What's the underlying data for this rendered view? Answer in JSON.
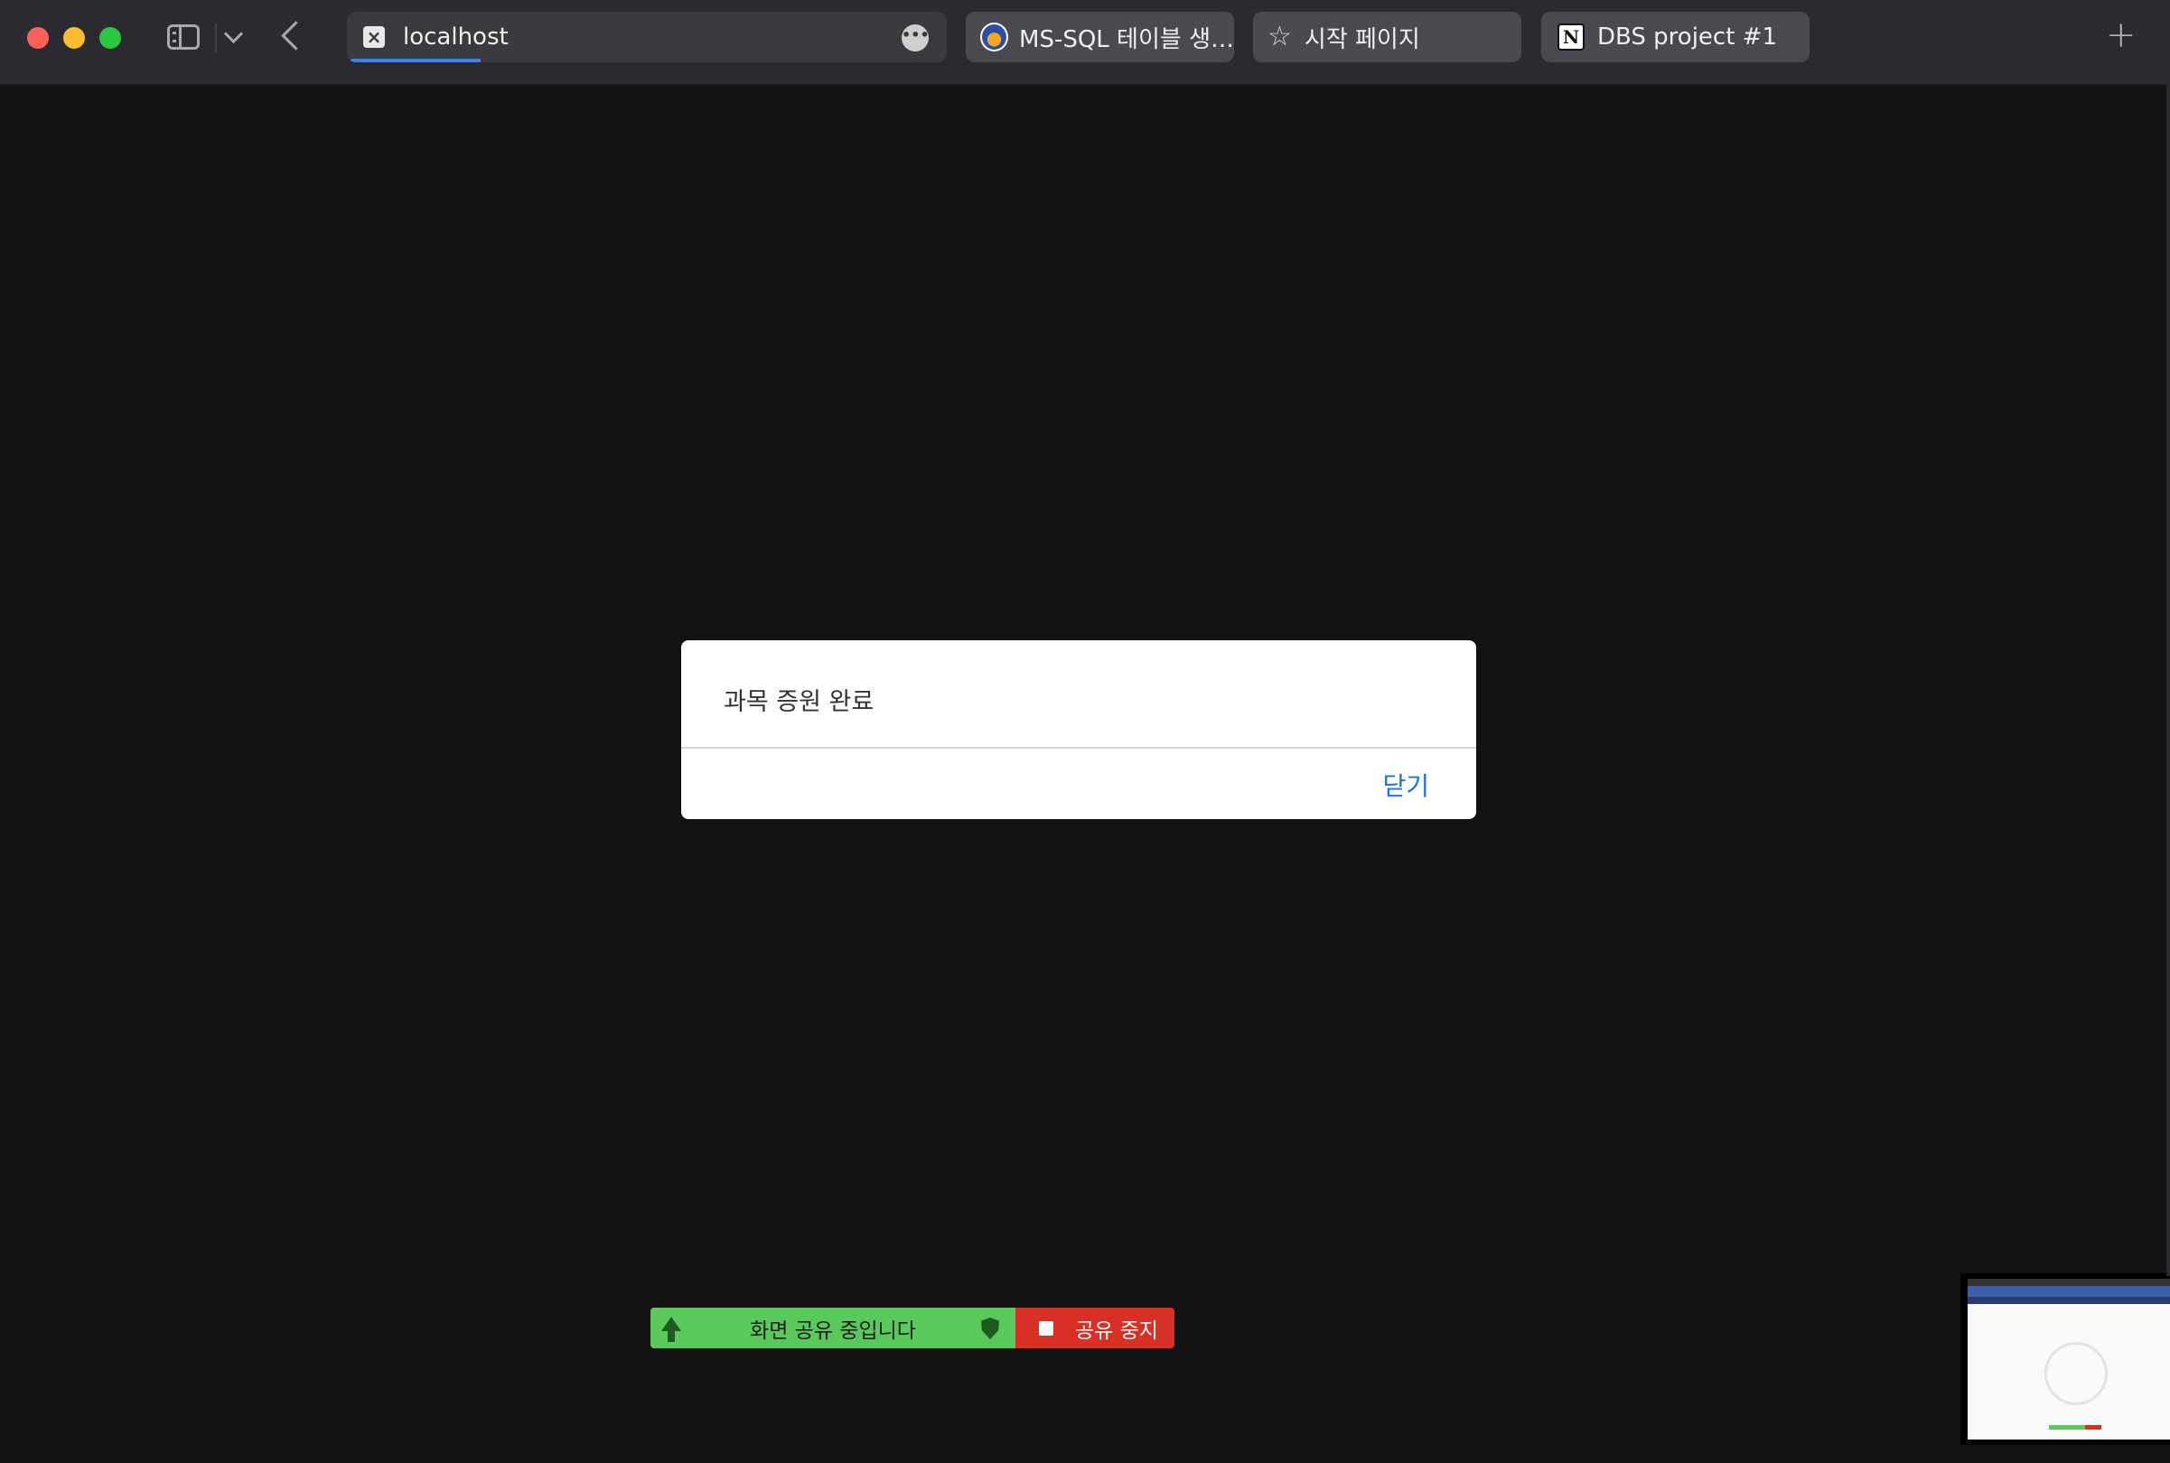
{
  "browser": {
    "tabs": [
      {
        "label": "localhost",
        "active": true,
        "favicon": "close-x-icon"
      },
      {
        "label": "MS-SQL 테이블 생…",
        "favicon": "globe-logo-icon"
      },
      {
        "label": "시작 페이지",
        "favicon": "star-icon"
      },
      {
        "label": "DBS project #1",
        "favicon": "notion-icon"
      }
    ],
    "new_tab_label": "+"
  },
  "dialog": {
    "message": "과목 증원 완료",
    "close_label": "닫기"
  },
  "share_bar": {
    "status_label": "화면 공유 중입니다",
    "stop_label": "공유 중지"
  },
  "colors": {
    "page_bg": "#121212",
    "titlebar": "#2b2a30",
    "link_blue": "#1a73e8",
    "share_green": "#5ac95c",
    "share_red": "#d93025"
  }
}
